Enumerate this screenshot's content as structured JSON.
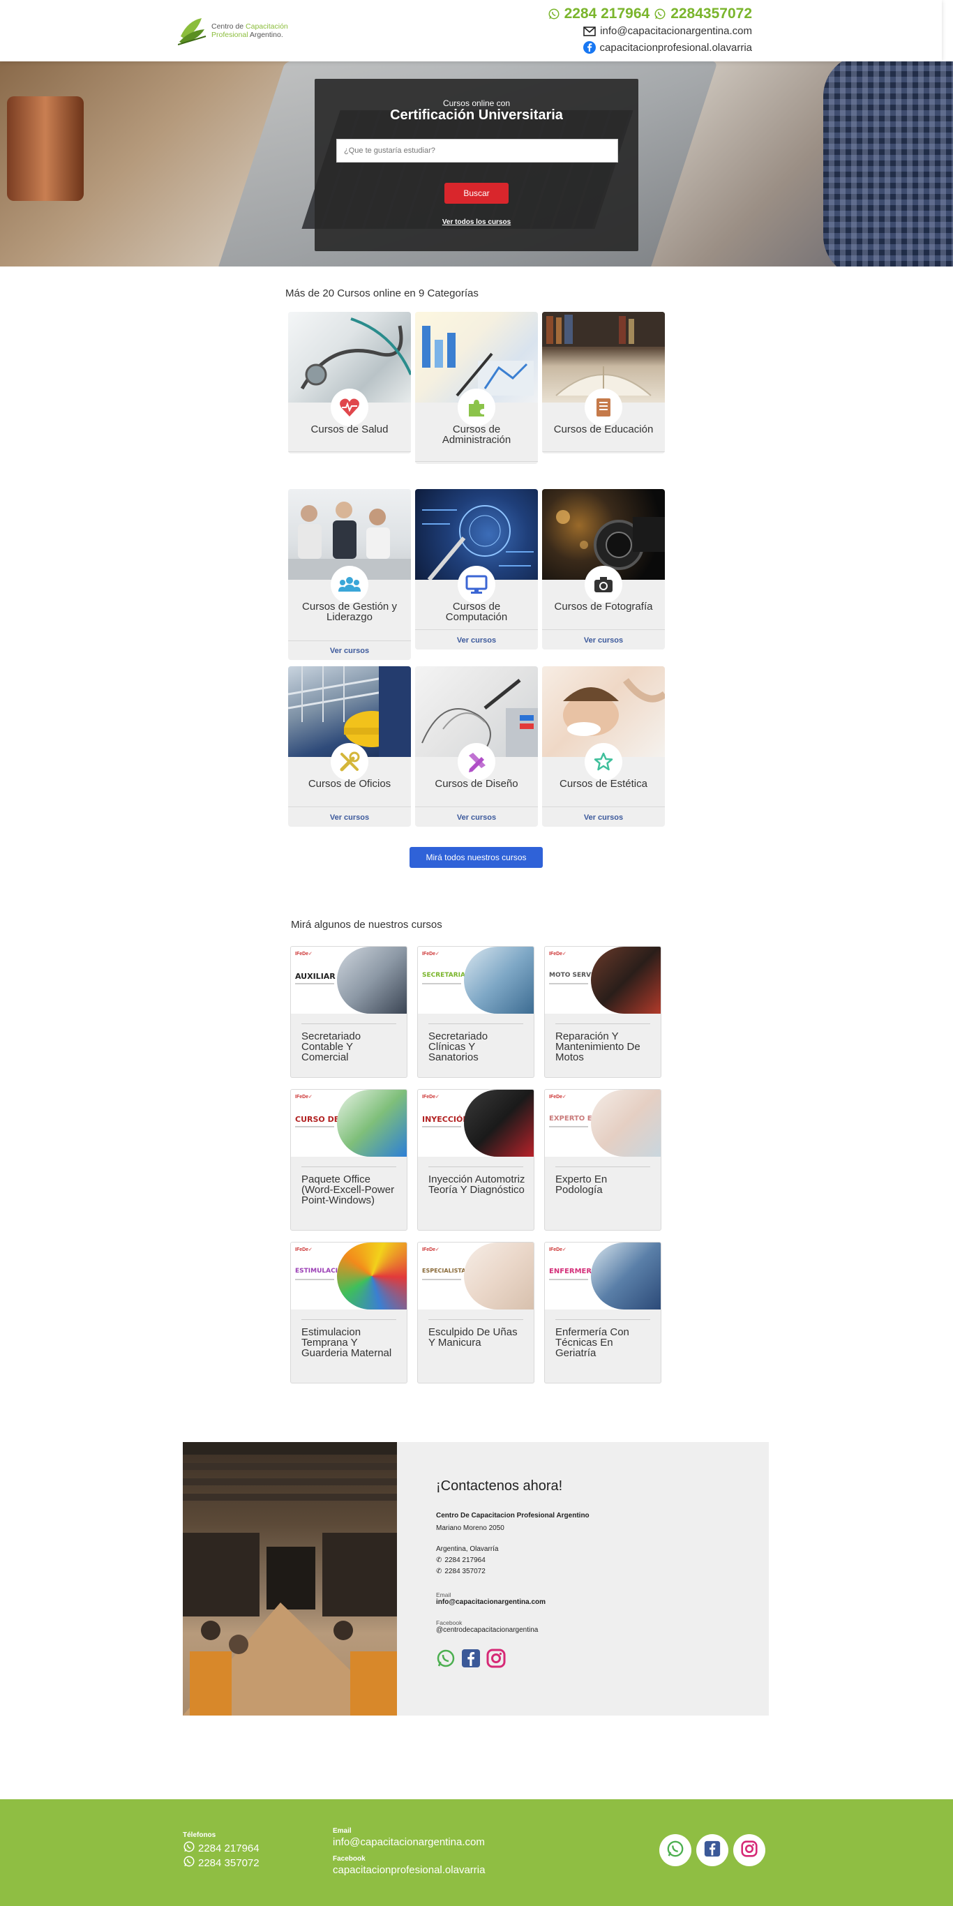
{
  "header": {
    "logo_line1": "Centro de",
    "logo_line1_green": "Capacitación",
    "logo_line2_green": "Profesional",
    "logo_line2": "Argentino.",
    "phone1": "2284 217964",
    "phone2": "2284357072",
    "email": "info@capacitacionargentina.com",
    "facebook": "capacitacionprofesional.olavarria"
  },
  "hero": {
    "subtitle": "Cursos online con",
    "title": "Certificación Universitaria",
    "search_placeholder": "¿Que te gustaría estudiar?",
    "search_button": "Buscar",
    "all_link": "Ver todos los cursos"
  },
  "categories": {
    "title": "Más de 20 Cursos online en 9 Categorías",
    "link_label": "Ver cursos",
    "items": [
      {
        "name": "Cursos de Salud",
        "icon": "heartbeat-icon",
        "color": "#e0474c"
      },
      {
        "name": "Cursos de Administración",
        "icon": "puzzle-icon",
        "color": "#8bc34a"
      },
      {
        "name": "Cursos de Educación",
        "icon": "book-icon",
        "color": "#c57a4a"
      },
      {
        "name": "Cursos de Gestión y Liderazgo",
        "icon": "users-icon",
        "color": "#3aa6d8"
      },
      {
        "name": "Cursos de Computación",
        "icon": "monitor-icon",
        "color": "#3b66d4"
      },
      {
        "name": "Cursos de Fotografía",
        "icon": "camera-icon",
        "color": "#333333"
      },
      {
        "name": "Cursos de Oficios",
        "icon": "tools-icon",
        "color": "#d4b63a"
      },
      {
        "name": "Cursos de Diseño",
        "icon": "design-icon",
        "color": "#b04fc7"
      },
      {
        "name": "Cursos de Estética",
        "icon": "star-icon",
        "color": "#3fbf9b"
      }
    ],
    "all_button": "Mirá todos nuestros cursos"
  },
  "courses": {
    "title": "Mirá algunos de nuestros cursos",
    "items": [
      {
        "name": "Secretariado Contable Y Comercial",
        "banner": "AUXILIAR",
        "banner_color": "#222222"
      },
      {
        "name": "Secretariado Clínicas Y Sanatorios",
        "banner": "SECRETARIADO",
        "banner_color": "#7ab52c"
      },
      {
        "name": "Reparación Y Mantenimiento De Motos",
        "banner": "MOTO SERVICE",
        "banner_color": "#666666"
      },
      {
        "name": "Paquete Office (Word-Excell-Power Point-Windows)",
        "banner": "CURSO DE",
        "banner_color": "#b22222"
      },
      {
        "name": "Inyección Automotriz Teoría Y Diagnóstico",
        "banner": "INYECCIÓN",
        "banner_color": "#b22222"
      },
      {
        "name": "Experto En Podología",
        "banner": "EXPERTO EN",
        "banner_color": "#c97b7b"
      },
      {
        "name": "Estimulacion Temprana Y Guarderia Maternal",
        "banner": "ESTIMULACIÓN",
        "banner_color": "#9b3fb5"
      },
      {
        "name": "Esculpido De Uñas Y Manicura",
        "banner": "ESPECIALISTA EN",
        "banner_color": "#8a6b3a"
      },
      {
        "name": "Enfermería Con Técnicas En Geriatría",
        "banner": "ENFERMERÍA",
        "banner_color": "#d4307a"
      }
    ],
    "brand": "IFeDe✓"
  },
  "contact": {
    "title": "¡Contactenos ahora!",
    "org": "Centro De Capacitacion Profesional Argentino",
    "address": "Mariano Moreno 2050",
    "city": "Argentina, Olavarría",
    "phone1": "2284 217964",
    "phone2": "2284 357072",
    "email_label": "Email",
    "email": "info@capacitacionargentina.com",
    "facebook_label": "Facebook",
    "facebook": "@centrodecapacitacionargentina"
  },
  "footer": {
    "phones_label": "Télefonos",
    "phone1": "2284 217964",
    "phone2": "2284 357072",
    "email_label": "Email",
    "email": "info@capacitacionargentina.com",
    "facebook_label": "Facebook",
    "facebook": "capacitacionprofesional.olavarria"
  },
  "colors": {
    "brand_green": "#8fbe43",
    "search_red": "#d9262c",
    "button_blue": "#2f62d8",
    "link_blue": "#3d5a9c"
  }
}
